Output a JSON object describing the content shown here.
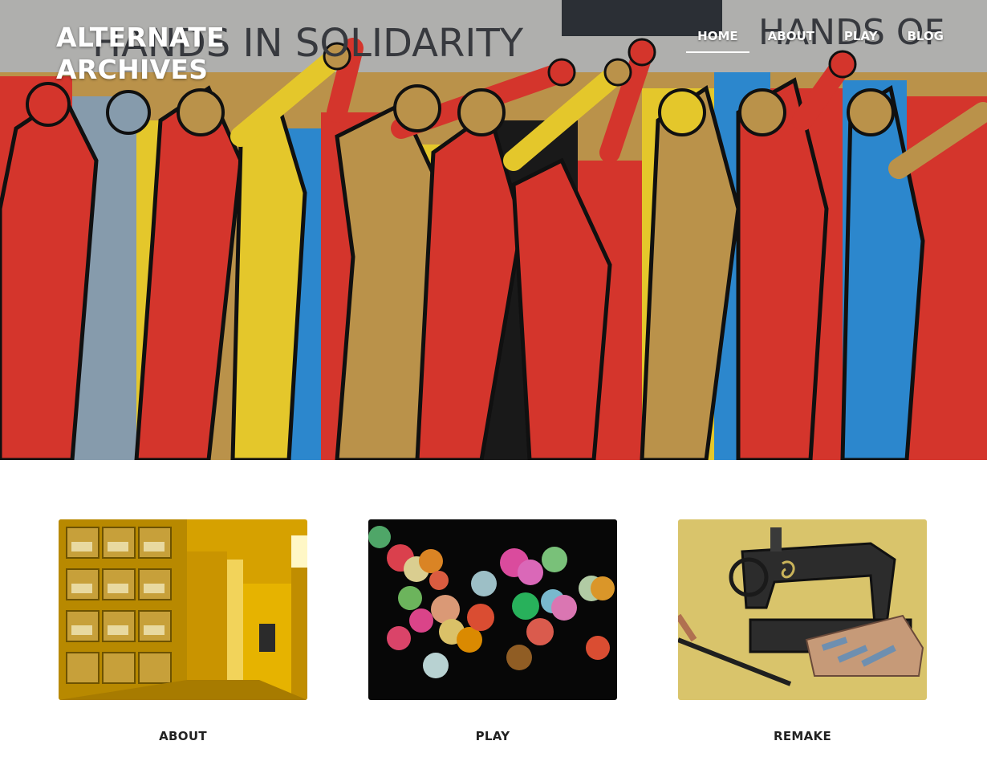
{
  "site": {
    "title_line1": "ALTERNATE",
    "title_line2": "ARCHIVES"
  },
  "hero": {
    "image": "solidarity-mural",
    "mural_text_left": "HANDS IN SOLIDARITY",
    "mural_text_right": "HANDS OF"
  },
  "nav": {
    "items": [
      {
        "label": "HOME",
        "active": true
      },
      {
        "label": "ABOUT",
        "active": false
      },
      {
        "label": "PLAY",
        "active": false
      },
      {
        "label": "BLOG",
        "active": false
      }
    ]
  },
  "cards": [
    {
      "label": "ABOUT",
      "image": "archive-shelves"
    },
    {
      "label": "PLAY",
      "image": "bokeh-lights"
    },
    {
      "label": "REMAKE",
      "image": "sewing-machine-mural"
    }
  ]
}
